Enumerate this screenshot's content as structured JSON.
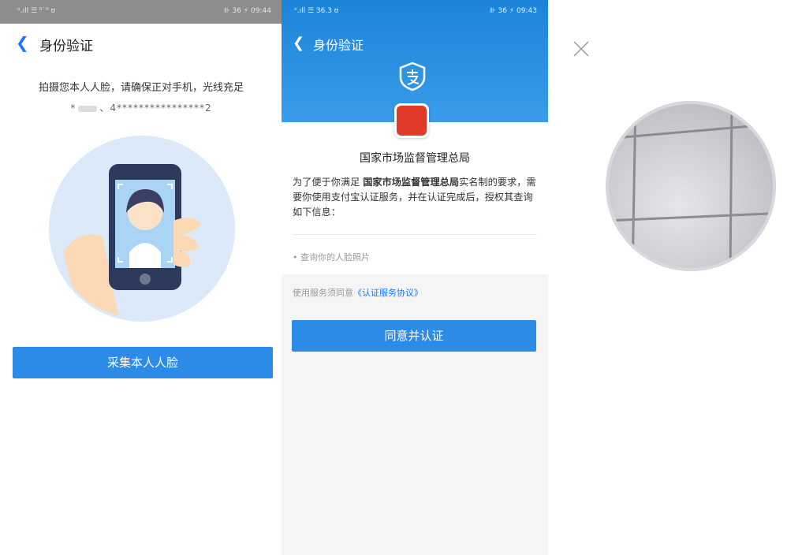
{
  "panel1": {
    "status": {
      "left": "ᵒ.ıll ☰ ⁰˙⁰ ʊ",
      "right": "⊪ 36 ⚡ 09:44"
    },
    "title": "身份验证",
    "instruction": "拍摄您本人人脸，请确保正对手机，光线充足",
    "masked_id_prefix": "*",
    "masked_id_suffix": "、4****************2",
    "button": "采集本人人脸"
  },
  "panel2": {
    "status": {
      "left": "ᵒ.ıll ☰ 36.3 ʊ",
      "right": "⊪ 36 ⚡ 09:43"
    },
    "title": "身份验证",
    "agency": "国家市场监督管理总局",
    "desc_pre": "为了便于你满足 ",
    "desc_bold": "国家市场监督管理总局",
    "desc_post": "实名制的要求，需要你使用支付宝认证服务，并在认证完成后，授权其查询如下信息：",
    "bullet": "• 查询你的人脸照片",
    "agree_pre": "使用服务须同意",
    "agree_link": "《认证服务协议》",
    "button": "同意并认证"
  },
  "colors": {
    "accent": "#2d8be8",
    "header_blue": "#1b84d9",
    "link": "#1677ff"
  }
}
